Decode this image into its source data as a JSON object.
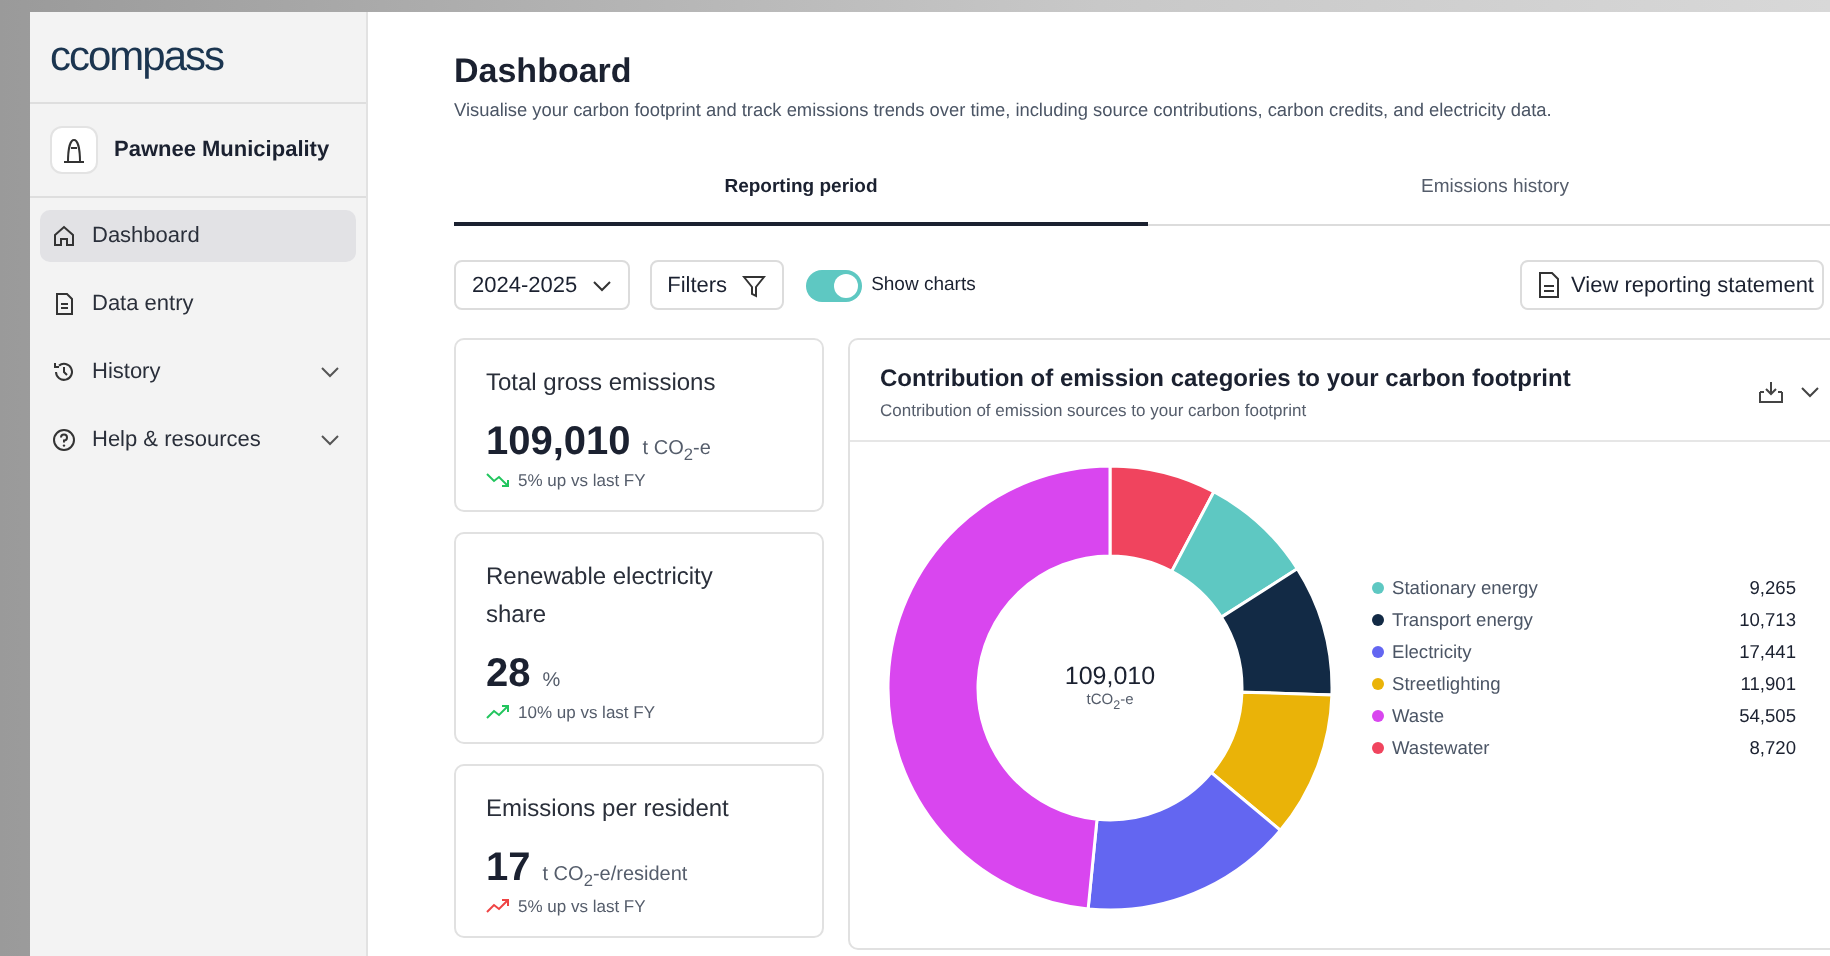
{
  "logo": {
    "text": "ccompass"
  },
  "org": {
    "name": "Pawnee Municipality"
  },
  "nav": [
    {
      "label": "Dashboard",
      "selected": true,
      "expandable": false
    },
    {
      "label": "Data entry",
      "selected": false,
      "expandable": false
    },
    {
      "label": "History",
      "selected": false,
      "expandable": true
    },
    {
      "label": "Help & resources",
      "selected": false,
      "expandable": true
    }
  ],
  "page": {
    "title": "Dashboard",
    "subtitle": "Visualise your carbon footprint and track emissions trends over time, including source contributions, carbon credits, and electricity data."
  },
  "tabs": [
    {
      "label": "Reporting period",
      "selected": true
    },
    {
      "label": "Emissions history",
      "selected": false
    }
  ],
  "toolbar": {
    "period": "2024-2025",
    "filters": "Filters",
    "toggle": {
      "label": "Show charts",
      "on": true
    },
    "statement_button": "View reporting statement"
  },
  "metrics": [
    {
      "title": "Total gross emissions",
      "value": "109,010",
      "unit": "t CO$_{2}$-e",
      "kind": "falling",
      "color": "#22c55e",
      "change": "5% up vs last FY"
    },
    {
      "title": "Renewable electricity share",
      "value": "28",
      "unit": "%",
      "kind": "rising",
      "color": "#22c55e",
      "change": "10% up vs last FY"
    },
    {
      "title": "Emissions per resident",
      "value": "17",
      "unit": "t CO$_{2}$-e/resident",
      "kind": "rising",
      "color": "#ef4444",
      "change": "5% up vs last FY"
    }
  ],
  "contribution": {
    "title": "Contribution of emission categories to your carbon footprint",
    "subtitle": "Contribution of emission sources to your carbon footprint",
    "center_value": "109,010",
    "center_unit": "tCO$_{2}$-e",
    "chart_data": {
      "type": "donut",
      "categories": [
        "Stationary energy",
        "Transport energy",
        "Electricity",
        "Streetlighting",
        "Waste",
        "Wastewater"
      ],
      "values": [
        9265,
        10713,
        17441,
        11901,
        54505,
        8720
      ],
      "value_labels": [
        "9,265",
        "10,713",
        "17,441",
        "11,901",
        "54,505",
        "8,720"
      ],
      "legend": "right",
      "colors": [
        "#5ec8c2",
        "#122a45",
        "#6366f1",
        "#eab308",
        "#d946ef",
        "#f0445e"
      ]
    }
  }
}
